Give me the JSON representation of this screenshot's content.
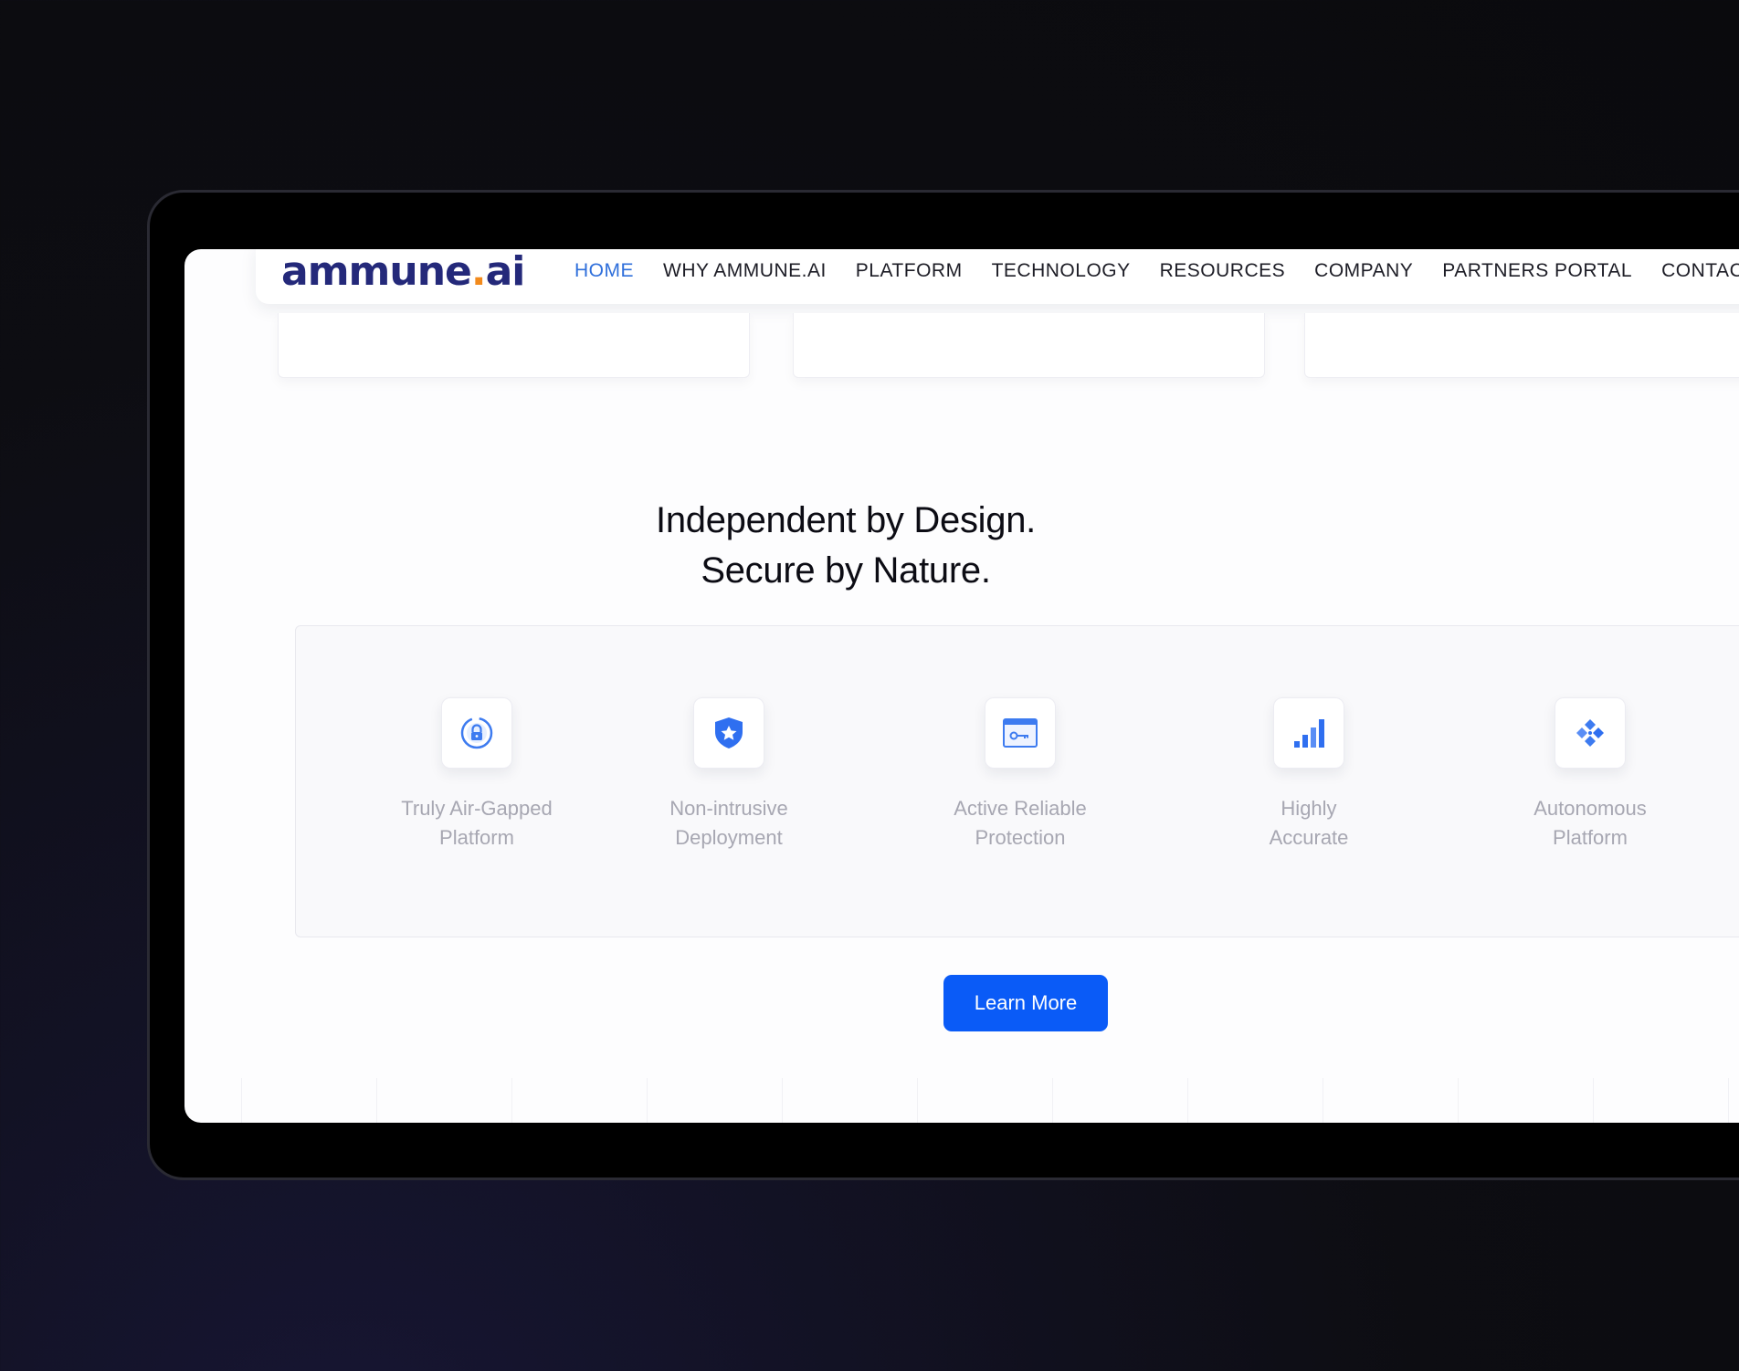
{
  "brand": {
    "logo_main": "ammune",
    "logo_dot": ".",
    "logo_suffix": "ai"
  },
  "nav": {
    "items": [
      {
        "label": "HOME",
        "active": true
      },
      {
        "label": "WHY AMMUNE.AI"
      },
      {
        "label": "PLATFORM"
      },
      {
        "label": "TECHNOLOGY"
      },
      {
        "label": "RESOURCES"
      },
      {
        "label": "COMPANY"
      },
      {
        "label": "PARTNERS PORTAL"
      },
      {
        "label": "CONTACT"
      }
    ]
  },
  "section": {
    "headline_line1": "Independent by Design.",
    "headline_line2": "Secure by Nature."
  },
  "features": [
    {
      "icon": "lock-icon",
      "label": "Truly Air-Gapped\nPlatform"
    },
    {
      "icon": "shield-star-icon",
      "label": "Non-intrusive\nDeployment"
    },
    {
      "icon": "key-card-icon",
      "label": "Active Reliable\nProtection"
    },
    {
      "icon": "bar-chart-icon",
      "label": "Highly\nAccurate"
    },
    {
      "icon": "diamond-arrows-icon",
      "label": "Autonomous\nPlatform"
    }
  ],
  "cta": {
    "learn_more_label": "Learn More"
  },
  "colors": {
    "accent": "#0A5BF7",
    "nav_active": "#2F6FDB",
    "logo_navy": "#24297A",
    "logo_dot": "#F28A1C"
  }
}
